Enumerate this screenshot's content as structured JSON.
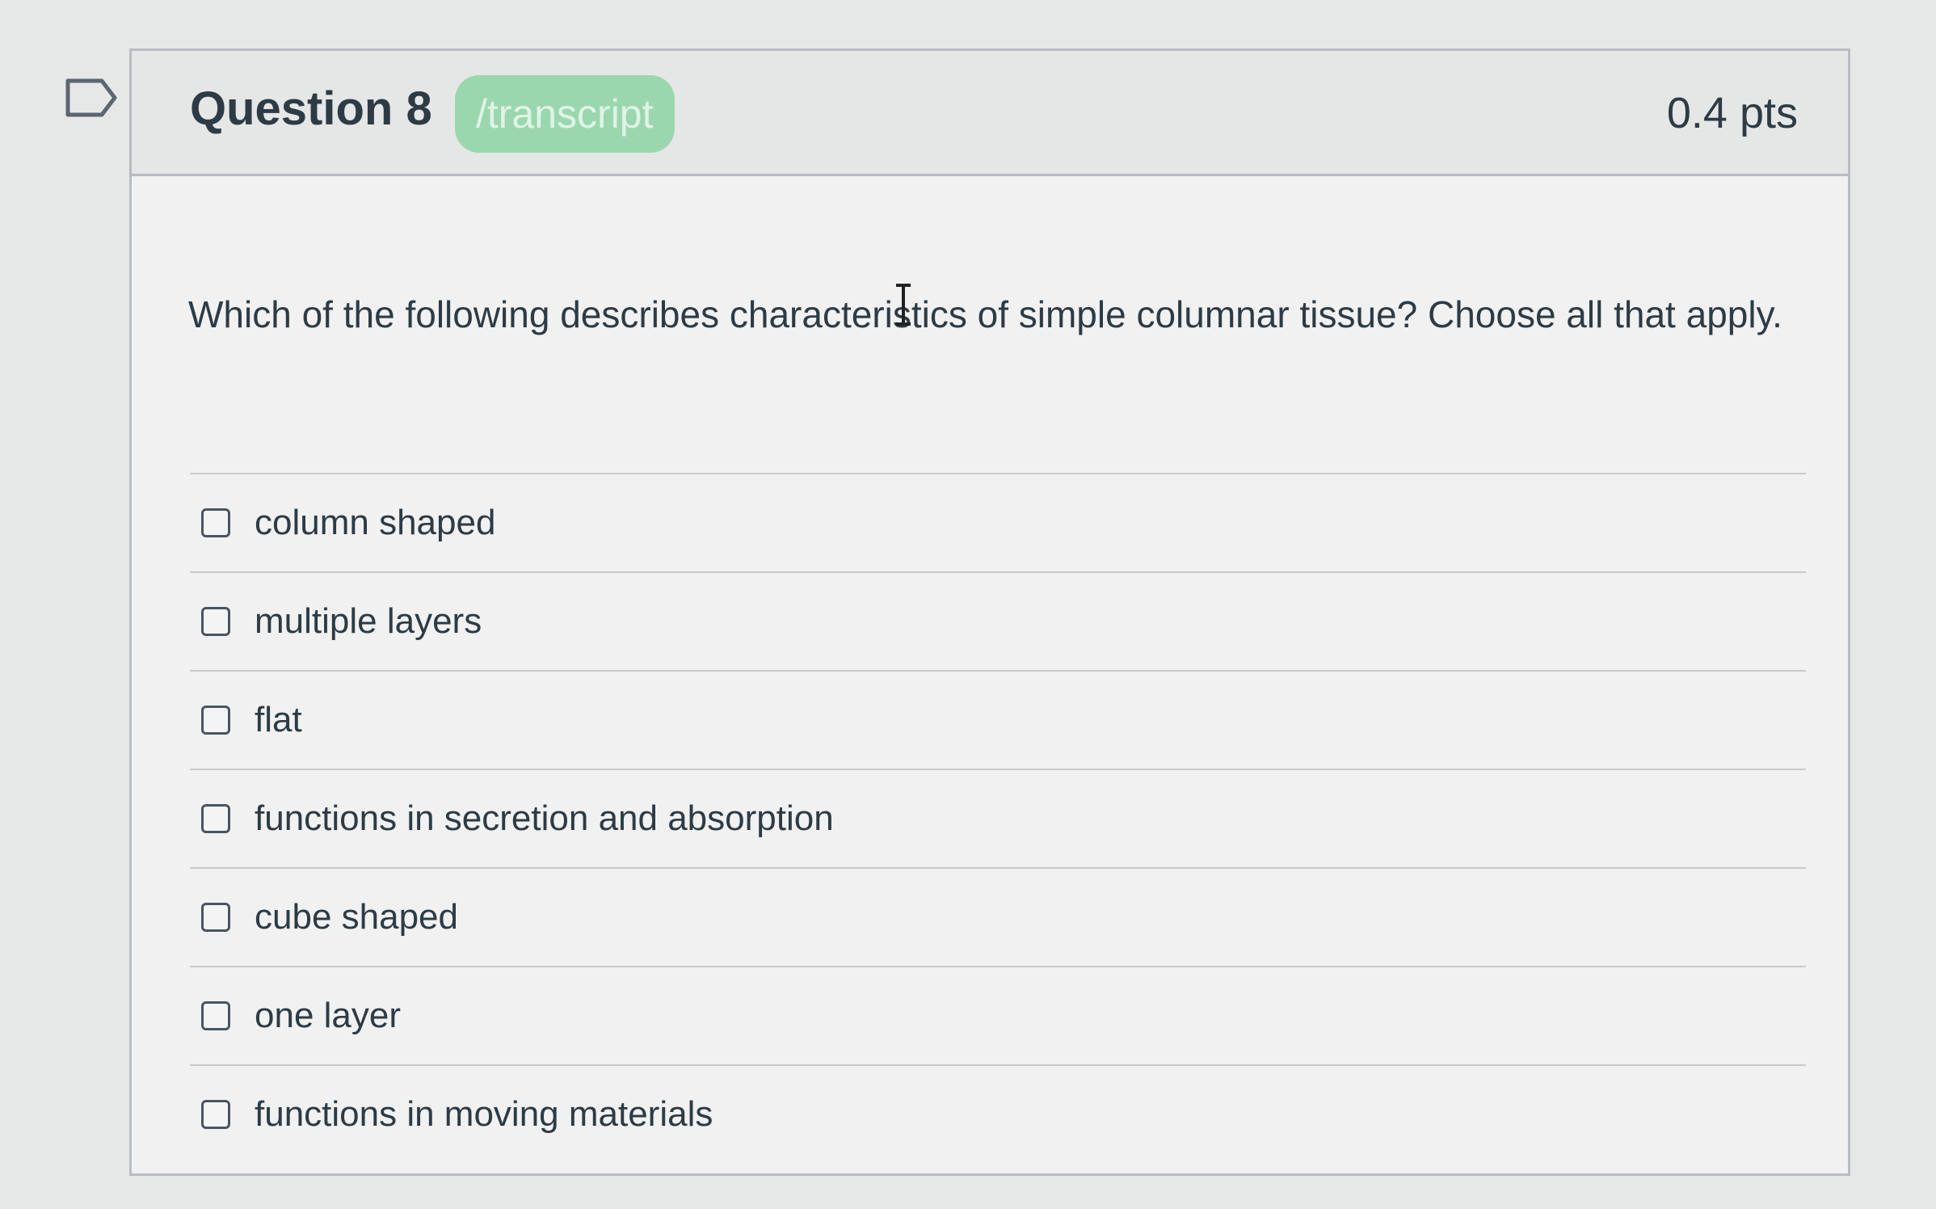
{
  "question": {
    "title": "Question 8",
    "badge": "/transcript",
    "points": "0.4 pts",
    "text": "Which of the following describes characteristics of simple columnar tissue?  Choose all that apply."
  },
  "answers": [
    {
      "label": "column shaped",
      "checked": false
    },
    {
      "label": "multiple layers",
      "checked": false
    },
    {
      "label": "flat",
      "checked": false
    },
    {
      "label": "functions in secretion and absorption",
      "checked": false
    },
    {
      "label": "cube shaped",
      "checked": false
    },
    {
      "label": "one layer",
      "checked": false
    },
    {
      "label": "functions in moving materials",
      "checked": false
    }
  ],
  "colors": {
    "badge": "#9bd7ae",
    "text": "#2d3b45",
    "border": "#b9bcbf"
  }
}
